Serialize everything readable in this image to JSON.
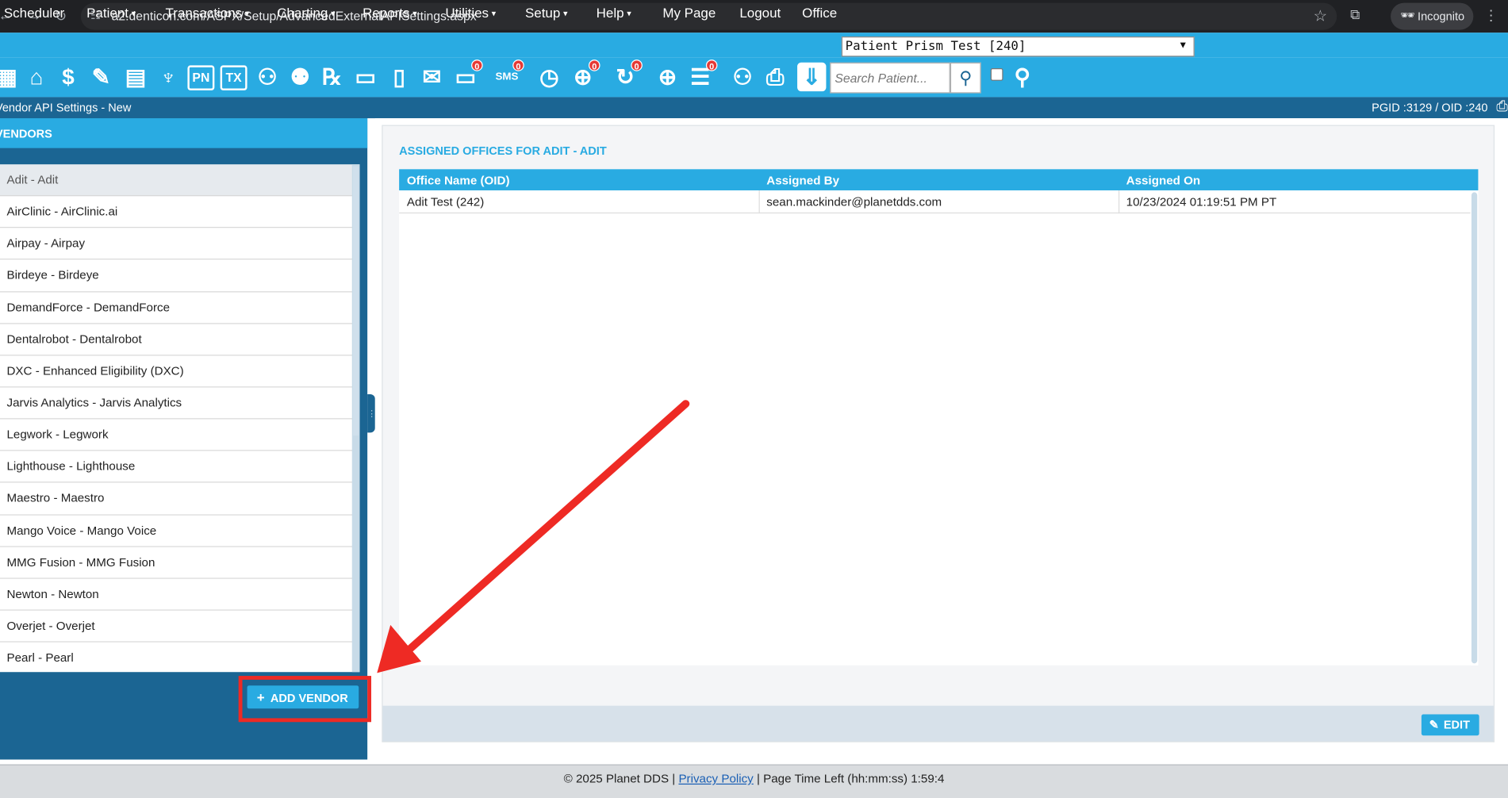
{
  "browser": {
    "url": "a2.denticon.com/ASPX/Setup/AdvancedExternalAPISettings.aspx",
    "incognito_label": "Incognito"
  },
  "menu": {
    "items": [
      {
        "label": "Scheduler",
        "has_dropdown": false
      },
      {
        "label": "Patient",
        "has_dropdown": true
      },
      {
        "label": "Transactions",
        "has_dropdown": true
      },
      {
        "label": "Charting",
        "has_dropdown": true
      },
      {
        "label": "Reports",
        "has_dropdown": true
      },
      {
        "label": "Utilities",
        "has_dropdown": true
      },
      {
        "label": "Setup",
        "has_dropdown": true
      },
      {
        "label": "Help",
        "has_dropdown": true
      },
      {
        "label": "My Page",
        "has_dropdown": false
      },
      {
        "label": "Logout",
        "has_dropdown": false
      }
    ],
    "office_label": "Office",
    "office_value": "Patient Prism Test [240]"
  },
  "toolbar": {
    "pn_label": "PN",
    "tx_label": "TX",
    "sms_label": "SMS",
    "badge_messages": "0",
    "badge_sms": "0",
    "badge_alerts": "0",
    "badge_recall": "0",
    "badge_forms": "0",
    "search_placeholder": "Search Patient..."
  },
  "titlebar": {
    "title": "Vendor API Settings - New",
    "ids": "PGID :3129  /  OID :240"
  },
  "vendors": {
    "header": "VENDORS",
    "items": [
      "Adit - Adit",
      "AirClinic - AirClinic.ai",
      "Airpay - Airpay",
      "Birdeye - Birdeye",
      "DemandForce - DemandForce",
      "Dentalrobot - Dentalrobot",
      "DXC - Enhanced Eligibility (DXC)",
      "Jarvis Analytics - Jarvis Analytics",
      "Legwork - Legwork",
      "Lighthouse - Lighthouse",
      "Maestro - Maestro",
      "Mango Voice - Mango Voice",
      "MMG Fusion - MMG Fusion",
      "Newton - Newton",
      "Overjet - Overjet",
      "Pearl - Pearl"
    ],
    "selected_index": 0,
    "add_button": "ADD VENDOR"
  },
  "assigned": {
    "title": "ASSIGNED OFFICES FOR ADIT - ADIT",
    "columns": [
      "Office Name (OID)",
      "Assigned By",
      "Assigned On"
    ],
    "rows": [
      [
        "Adit Test (242)",
        "sean.mackinder@planetdds.com",
        "10/23/2024 01:19:51 PM PT"
      ]
    ],
    "edit_button": "EDIT"
  },
  "footer": {
    "copyright": "© 2025 Planet DDS |",
    "privacy": "Privacy Policy",
    "time_left": "| Page Time Left (hh:mm:ss) 1:59:4"
  },
  "colors": {
    "accent": "#29abe2",
    "dark": "#1b6593",
    "highlight": "#ee2a24"
  }
}
